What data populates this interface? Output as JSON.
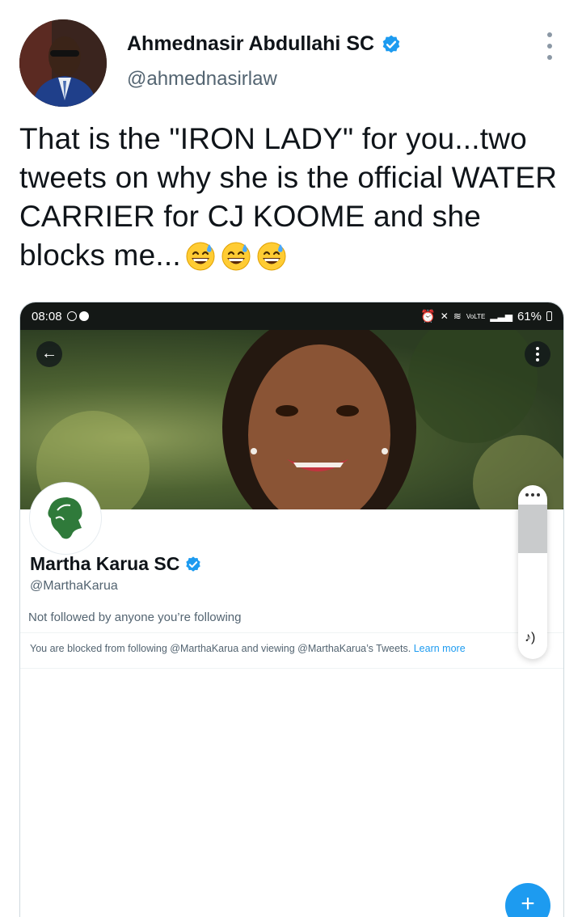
{
  "tweet": {
    "author_name": "Ahmednasir Abdullahi SC",
    "author_handle": "@ahmednasirlaw",
    "text": "That is the \"IRON LADY\" for you...two tweets on why she is the official WATER CARRIER for CJ KOOME and she blocks me...",
    "emojis": [
      "grinning-sweat-emoji",
      "grinning-sweat-emoji",
      "grinning-sweat-emoji"
    ]
  },
  "screenshot": {
    "status_bar": {
      "time": "08:08",
      "network": "VoLTE",
      "battery": "61%"
    },
    "profile": {
      "name": "Martha Karua SC",
      "handle": "@MarthaKarua",
      "followed_by": "Not followed by anyone you’re following",
      "blocked_text": "You are blocked from following @MarthaKarua and viewing @MarthaKarua’s Tweets.",
      "learn_more": "Learn more"
    },
    "fab_label": "+"
  },
  "colors": {
    "accent": "#1d9bf0",
    "text_primary": "#0f1419",
    "text_secondary": "#536471"
  }
}
